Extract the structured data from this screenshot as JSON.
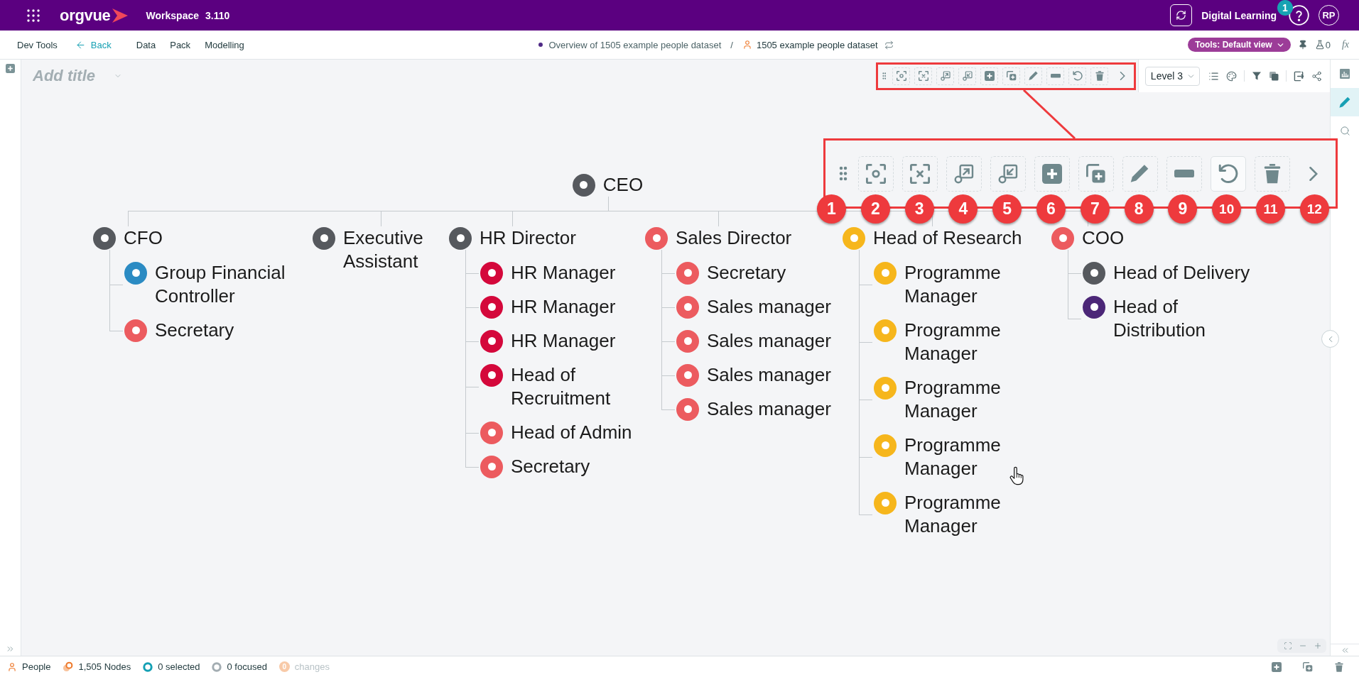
{
  "app_bar": {
    "brand": "orgvue",
    "workspace": "Workspace",
    "version": "3.110",
    "account": "Digital Learning",
    "notification_count": "1",
    "avatar_initials": "RP"
  },
  "nav_bar": {
    "links": [
      {
        "label": "Dev Tools",
        "kind": "link"
      },
      {
        "label": "Back",
        "kind": "back"
      },
      {
        "label": "Data",
        "kind": "link"
      },
      {
        "label": "Pack",
        "kind": "link"
      },
      {
        "label": "Modelling",
        "kind": "link"
      }
    ],
    "breadcrumb": {
      "view": "Overview of 1505 example people dataset",
      "separator": "/",
      "dataset": "1505 example people dataset"
    },
    "tools_button": "Tools: Default view",
    "flask_count": "0",
    "formula_button": "fx"
  },
  "canvas": {
    "title": {
      "placeholder": "Add title"
    },
    "level_select": "Level 3"
  },
  "org_chart": {
    "root": {
      "label": "CEO",
      "color": "#56595e",
      "children": [
        {
          "label": "CFO",
          "color": "#56595e",
          "children": [
            {
              "label": "Group Financial Controller",
              "color": "#2b8bc3"
            },
            {
              "label": "Secretary",
              "color": "#ec5b5f"
            }
          ]
        },
        {
          "label": "Executive Assistant",
          "color": "#56595e"
        },
        {
          "label": "HR Director",
          "color": "#56595e",
          "children": [
            {
              "label": "HR Manager",
              "color": "#d4083b"
            },
            {
              "label": "HR Manager",
              "color": "#d4083b"
            },
            {
              "label": "HR Manager",
              "color": "#d4083b"
            },
            {
              "label": "Head of Recruitment",
              "color": "#d4083b"
            },
            {
              "label": "Head of Admin",
              "color": "#ec5b5f"
            },
            {
              "label": "Secretary",
              "color": "#ec5b5f"
            }
          ]
        },
        {
          "label": "Sales Director",
          "color": "#ec5b5f",
          "children": [
            {
              "label": "Secretary",
              "color": "#ec5b5f"
            },
            {
              "label": "Sales manager",
              "color": "#ec5b5f"
            },
            {
              "label": "Sales manager",
              "color": "#ec5b5f"
            },
            {
              "label": "Sales manager",
              "color": "#ec5b5f"
            },
            {
              "label": "Sales manager",
              "color": "#ec5b5f"
            }
          ]
        },
        {
          "label": "Head of Research",
          "color": "#f6b61c",
          "children": [
            {
              "label": "Programme Manager",
              "color": "#f6b61c"
            },
            {
              "label": "Programme Manager",
              "color": "#f6b61c"
            },
            {
              "label": "Programme Manager",
              "color": "#f6b61c"
            },
            {
              "label": "Programme Manager",
              "color": "#f6b61c"
            },
            {
              "label": "Programme Manager",
              "color": "#f6b61c"
            }
          ]
        },
        {
          "label": "COO",
          "color": "#ec5b5f",
          "children": [
            {
              "label": "Head of Delivery",
              "color": "#56595e"
            },
            {
              "label": "Head of Distribution",
              "color": "#4b2677"
            }
          ]
        }
      ]
    }
  },
  "callout": {
    "markers": [
      "1",
      "2",
      "3",
      "4",
      "5",
      "6",
      "7",
      "8",
      "9",
      "10",
      "11",
      "12"
    ]
  },
  "right_rail": {
    "tools": [
      {
        "kind": "chart",
        "selected": false
      },
      {
        "kind": "edit",
        "selected": true
      },
      {
        "kind": "search",
        "selected": false
      }
    ]
  },
  "status_bar": {
    "items": [
      {
        "kind": "dataset",
        "label": "People",
        "disabled": false
      },
      {
        "kind": "nodes",
        "label": "1,505 Nodes",
        "disabled": false
      },
      {
        "kind": "selected",
        "label": "0 selected",
        "disabled": false
      },
      {
        "kind": "focused",
        "label": "0 focused",
        "disabled": false
      },
      {
        "kind": "changes",
        "count": "0",
        "label": "changes",
        "disabled": true
      }
    ]
  }
}
